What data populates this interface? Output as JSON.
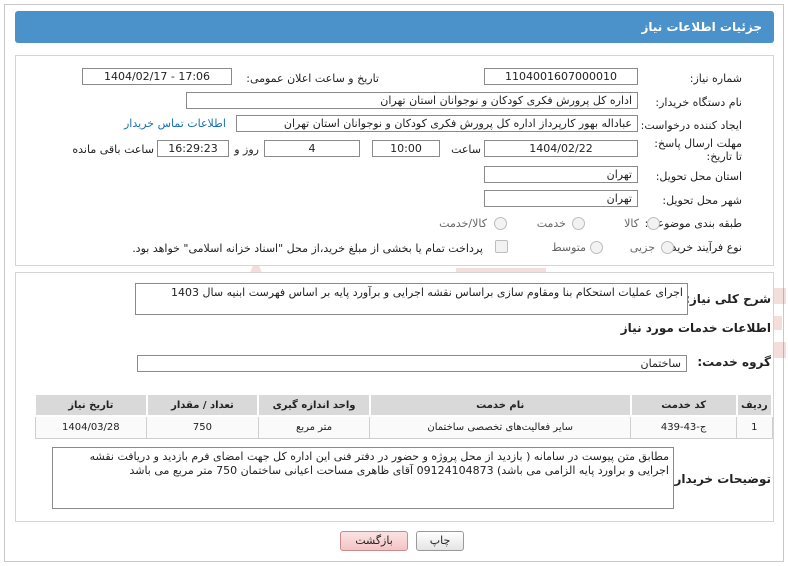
{
  "header": {
    "title": "جزئیات اطلاعات نیاز"
  },
  "fields": {
    "need_number_label": "شماره نیاز:",
    "need_number": "1104001607000010",
    "announce_label": "تاریخ و ساعت اعلان عمومی:",
    "announce_value": "1404/02/17 - 17:06",
    "buyer_org_label": "نام دستگاه خریدار:",
    "buyer_org": "اداره کل پرورش فکری کودکان و نوجوانان استان تهران",
    "requester_label": "ایجاد کننده درخواست:",
    "requester": "عباداله بهور کارپرداز اداره کل پرورش فکری کودکان و نوجوانان استان تهران",
    "contact_link": "اطلاعات تماس خریدار",
    "deadline_label": "مهلت ارسال پاسخ: تا تاریخ:",
    "deadline_date": "1404/02/22",
    "time_label": "ساعت",
    "deadline_time": "10:00",
    "days_value": "4",
    "days_label": "روز و",
    "remaining_time": "16:29:23",
    "remaining_label": "ساعت باقی مانده",
    "province_label": "استان محل تحویل:",
    "province": "تهران",
    "city_label": "شهر محل تحویل:",
    "city": "تهران",
    "category_label": "طبقه بندی موضوعی:",
    "category_options": [
      "کالا",
      "خدمت",
      "کالا/خدمت"
    ],
    "process_label": "نوع فرآیند خرید :",
    "process_options": [
      "جزیی",
      "متوسط"
    ],
    "payment_note": "پرداخت تمام یا بخشی از مبلغ خرید،از محل \"اسناد خزانه اسلامی\" خواهد بود."
  },
  "description": {
    "label": "شرح کلی نیاز:",
    "text": "اجرای عملیات استحکام بنا ومقاوم سازی براساس نقشه اجرایی و برآورد پایه بر اساس فهرست ابنیه سال 1403"
  },
  "services": {
    "title": "اطلاعات خدمات مورد نیاز",
    "group_label": "گروه خدمت:",
    "group_value": "ساختمان",
    "columns": [
      "ردیف",
      "کد خدمت",
      "نام خدمت",
      "واحد اندازه گیری",
      "تعداد / مقدار",
      "تاریخ نیاز"
    ],
    "rows": [
      [
        "1",
        "ج-43-439",
        "سایر فعالیت‌های تخصصی ساختمان",
        "متر مربع",
        "750",
        "1404/03/28"
      ]
    ]
  },
  "buyer_notes": {
    "label": "توضیحات خریدار:",
    "text": "مطابق متن پیوست در سامانه ( بازدید از محل پروژه و حضور در دفتر فنی این اداره کل جهت امضای فرم بازدید و دریافت نقشه اجرایی و براورد پایه الزامی می باشد)   09124104873 آقای ظاهری مساحت اعیانی ساختمان 750 متر مربع می باشد"
  },
  "buttons": {
    "print": "چاپ",
    "back": "بازگشت"
  },
  "colors": {
    "header_bg": "#4a92c9",
    "link": "#1a6fb5",
    "back_button": "#f4c4c4"
  }
}
